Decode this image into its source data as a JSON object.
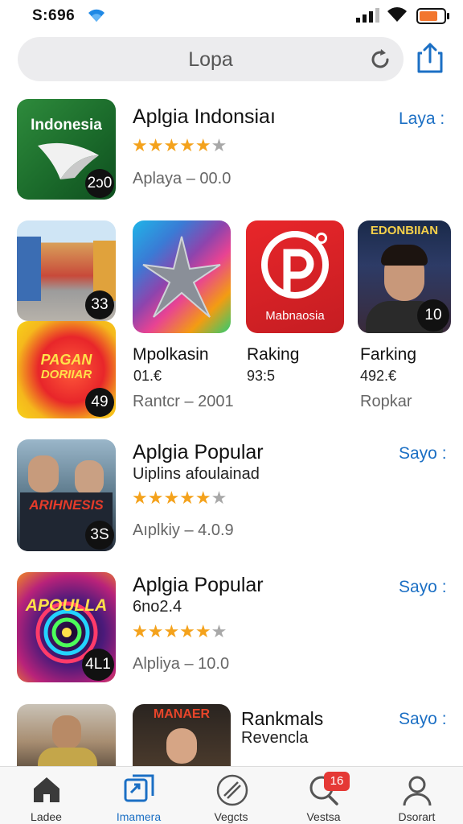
{
  "status_bar": {
    "time": "S:696"
  },
  "search": {
    "text": "Lopa"
  },
  "featured": {
    "title": "Aplgia Indonsiaı",
    "rating_stars": 4,
    "meta": "Aplaya  –   00.0",
    "action": "Laya :",
    "icon_label": "Indonesia",
    "badge": "2ↄ0"
  },
  "grid": {
    "tile1_badge": "33",
    "tile2_badge": "49",
    "tile2_text_line1": "PAGAN",
    "tile2_text_line2": "DORIIAR",
    "apps": [
      {
        "name": "Mpolkasin",
        "price": "01.€"
      },
      {
        "name": "Raking",
        "price": "93:5",
        "icon_label": "Mabnaosia"
      },
      {
        "name": "Farking",
        "price": "492.€",
        "icon_label": "EDONBIIAN",
        "badge": "10"
      }
    ],
    "meta_left": "Rantcr  –   2001",
    "meta_right": "Ropkar"
  },
  "list": [
    {
      "title": "Aplgia Popular",
      "subtitle": "Uiplins afoulainad",
      "rating_stars": 4,
      "meta": "Aıplkiy  –   4.0.9",
      "action": "Sayo :",
      "icon_label": "ARIHNESIS",
      "badge": "3S"
    },
    {
      "title": "Aplgia Popular",
      "subtitle": "6no2.4",
      "rating_stars": 4,
      "meta": "Alpliya  –   10.0",
      "action": "Sayo :",
      "icon_label": "APOULLA",
      "badge": "4L1"
    },
    {
      "title": "Rankmals",
      "subtitle": "Revencla",
      "action": "Sayo :",
      "icon_label": "MANAER"
    }
  ],
  "tabbar": {
    "items": [
      {
        "label": "Ladee",
        "icon": "home-icon"
      },
      {
        "label": "Imamera",
        "icon": "apps-icon",
        "active": true
      },
      {
        "label": "Vegcts",
        "icon": "games-icon"
      },
      {
        "label": "Vestsa",
        "icon": "search-icon",
        "badge": "16"
      },
      {
        "label": "Dsorart",
        "icon": "profile-icon"
      }
    ]
  },
  "colors": {
    "accent": "#1b6fc4",
    "star": "#f4a21c",
    "badge_red": "#e53935"
  }
}
